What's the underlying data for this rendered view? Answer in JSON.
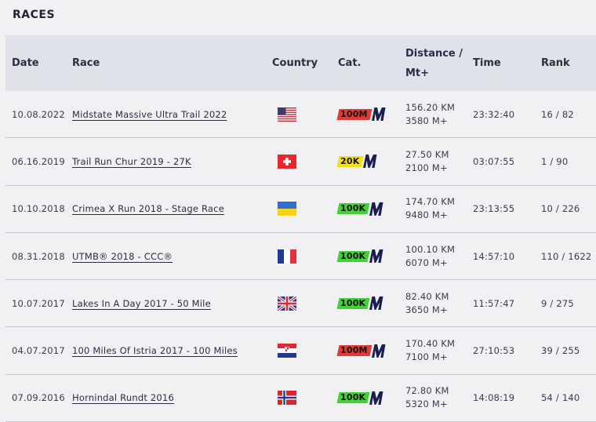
{
  "title": "RACES",
  "columns": {
    "date": "Date",
    "race": "Race",
    "country": "Country",
    "cat": "Cat.",
    "distance_line1": "Distance /",
    "distance_line2": "Mt+",
    "time": "Time",
    "rank": "Rank"
  },
  "category_colors": {
    "100M": "#e53935",
    "20K": "#f5e010",
    "100K": "#43d13a"
  },
  "rows": [
    {
      "date": "10.08.2022",
      "race": "Midstate Massive Ultra Trail 2022",
      "country": "us-flag",
      "cat": "100M",
      "distance": "156.20 KM",
      "elevation": "3580 M+",
      "time": "23:32:40",
      "rank": "16 / 82"
    },
    {
      "date": "06.16.2019",
      "race": "Trail Run Chur 2019 - 27K",
      "country": "ch-flag",
      "cat": "20K",
      "distance": "27.50 KM",
      "elevation": "2100 M+",
      "time": "03:07:55",
      "rank": "1 / 90"
    },
    {
      "date": "10.10.2018",
      "race": "Crimea X Run 2018 - Stage Race",
      "country": "ua-flag",
      "cat": "100K",
      "distance": "174.70 KM",
      "elevation": "9480 M+",
      "time": "23:13:55",
      "rank": "10 / 226"
    },
    {
      "date": "08.31.2018",
      "race": "UTMB® 2018 - CCC®",
      "country": "fr-flag",
      "cat": "100K",
      "distance": "100.10 KM",
      "elevation": "6070 M+",
      "time": "14:57:10",
      "rank": "110 / 1622"
    },
    {
      "date": "10.07.2017",
      "race": "Lakes In A Day 2017 - 50 Mile",
      "country": "gb-flag",
      "cat": "100K",
      "distance": "82.40 KM",
      "elevation": "3650 M+",
      "time": "11:57:47",
      "rank": "9 / 275"
    },
    {
      "date": "04.07.2017",
      "race": "100 Miles Of Istria 2017 - 100 Miles",
      "country": "hr-flag",
      "cat": "100M",
      "distance": "170.40 KM",
      "elevation": "7100 M+",
      "time": "27:10:53",
      "rank": "39 / 255"
    },
    {
      "date": "07.09.2016",
      "race": "Hornindal Rundt 2016",
      "country": "no-flag",
      "cat": "100K",
      "distance": "72.80 KM",
      "elevation": "5320 M+",
      "time": "14:08:19",
      "rank": "54 / 140"
    }
  ]
}
